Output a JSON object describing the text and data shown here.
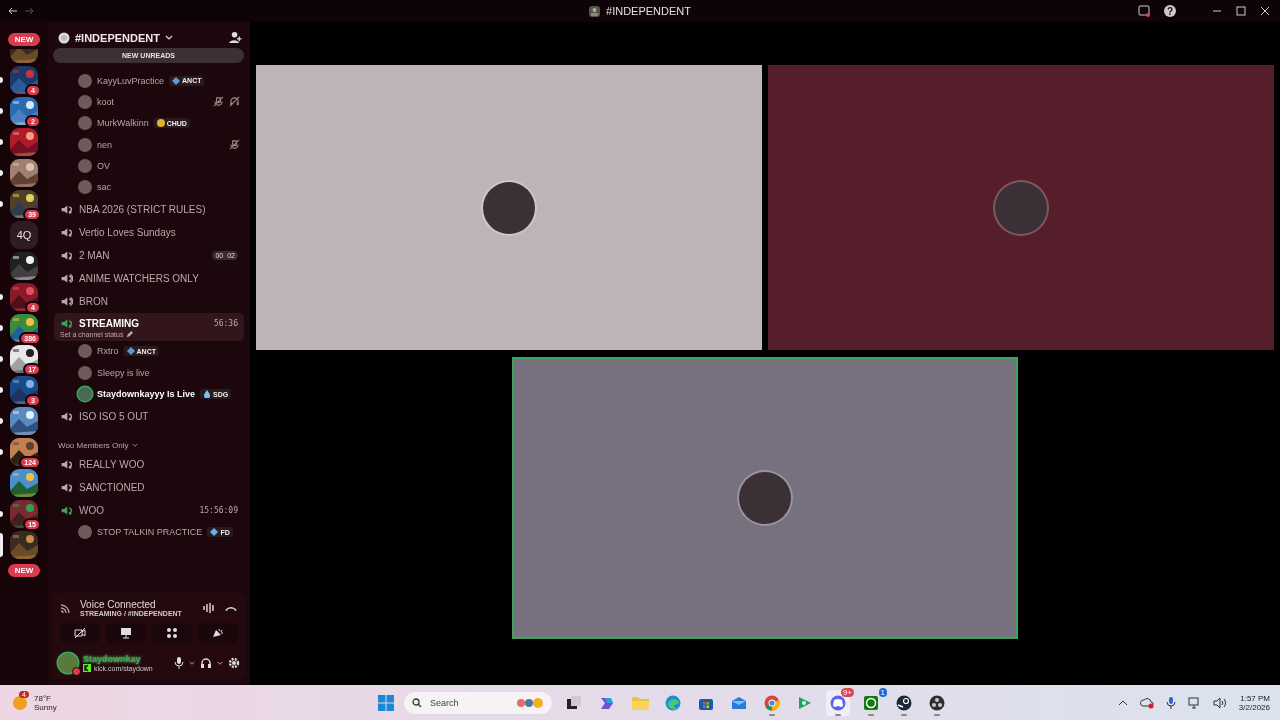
{
  "title_bar": {
    "title": "#INDEPENDENT",
    "help": "?"
  },
  "server_rail": {
    "top_pill": "NEW",
    "bottom_pill": "NEW",
    "servers": [
      {
        "kind": "picture",
        "unread": false,
        "selected": false
      },
      {
        "kind": "picture",
        "unread": true,
        "badge": "4",
        "selected": false
      },
      {
        "kind": "picture",
        "unread": true,
        "badge": "2",
        "selected": false
      },
      {
        "kind": "picture",
        "unread": true,
        "selected": false
      },
      {
        "kind": "picture",
        "unread": true,
        "selected": false
      },
      {
        "kind": "picture",
        "unread": true,
        "badge": "39",
        "selected": false
      },
      {
        "kind": "text",
        "label": "4Q",
        "unread": false,
        "selected": false
      },
      {
        "kind": "picture",
        "unread": false,
        "selected": false
      },
      {
        "kind": "picture",
        "unread": true,
        "badge": "4",
        "selected": false
      },
      {
        "kind": "picture",
        "unread": true,
        "badge": "386",
        "selected": false
      },
      {
        "kind": "picture",
        "unread": true,
        "badge": "17",
        "selected": false
      },
      {
        "kind": "picture",
        "unread": true,
        "badge": "3",
        "selected": false
      },
      {
        "kind": "picture",
        "unread": true,
        "selected": false
      },
      {
        "kind": "picture",
        "unread": true,
        "badge": "124",
        "selected": false
      },
      {
        "kind": "picture",
        "unread": false,
        "selected": false
      },
      {
        "kind": "picture",
        "unread": true,
        "badge": "15",
        "selected": false
      },
      {
        "kind": "picture",
        "unread": false,
        "selected": true
      }
    ]
  },
  "server_header": {
    "name": "#INDEPENDENT",
    "unreads_pill": "NEW UNREADS"
  },
  "top_members": [
    {
      "name": "KayyLuvPractice",
      "tag": {
        "text": "ANCT",
        "kind": "diamond",
        "color": "#5b9bd5"
      },
      "muted": false,
      "deafened": false,
      "speaking": false
    },
    {
      "name": "koot",
      "muted": true,
      "deafened": true,
      "speaking": false
    },
    {
      "name": "MurkWalkinn",
      "tag": {
        "text": "CHUD",
        "kind": "face",
        "color": "#e0b32a"
      },
      "muted": false,
      "deafened": false,
      "speaking": false
    },
    {
      "name": "nen",
      "muted": true,
      "deafened": false,
      "speaking": false
    },
    {
      "name": "OV",
      "muted": false,
      "deafened": false,
      "speaking": false
    },
    {
      "name": "sac",
      "muted": false,
      "deafened": false,
      "speaking": false
    }
  ],
  "channels": [
    {
      "name": "NBA 2026 (STRICT RULES)",
      "locked": true,
      "active": false,
      "selected": false
    },
    {
      "name": "Vertio Loves Sundays",
      "locked": true,
      "active": false,
      "selected": false
    },
    {
      "name": "2 MAN",
      "locked": true,
      "active": false,
      "selected": false,
      "counter": [
        "00",
        "02"
      ]
    },
    {
      "name": "ANIME WATCHERS ONLY",
      "locked": false,
      "active": false,
      "selected": false
    },
    {
      "name": "BRON",
      "locked": false,
      "active": false,
      "selected": false
    },
    {
      "name": "STREAMING",
      "locked": true,
      "active": true,
      "selected": true,
      "timer": "56:36",
      "status": "Set a channel status",
      "members": [
        {
          "name": "Rxtro",
          "tag": {
            "text": "ANCT",
            "kind": "diamond",
            "color": "#5b9bd5"
          },
          "muted": false,
          "deafened": false,
          "speaking": false
        },
        {
          "name": "Sleepy is live",
          "muted": false,
          "deafened": false,
          "speaking": false
        },
        {
          "name": "Staydownkayyy Is Live",
          "tag": {
            "text": "SDG",
            "kind": "drop",
            "color": "#7cc4f0"
          },
          "muted": false,
          "deafened": false,
          "speaking": true
        }
      ]
    },
    {
      "name": "ISO ISO 5 OUT",
      "locked": true,
      "active": false,
      "selected": false
    }
  ],
  "category": {
    "name": "Woo Members Only",
    "channels": [
      {
        "name": "REALLY WOO",
        "locked": true,
        "active": false,
        "selected": false
      },
      {
        "name": "SANCTIONED",
        "locked": true,
        "active": false,
        "selected": false
      },
      {
        "name": "WOO",
        "locked": true,
        "active": true,
        "selected": false,
        "timer": "15:56:09",
        "members": [
          {
            "name": "STOP TALKIN PRACTICE",
            "tag": {
              "text": "FD",
              "kind": "diamond",
              "color": "#6ab0f0"
            },
            "muted": false,
            "deafened": false,
            "speaking": false
          }
        ]
      }
    ]
  },
  "voice_panel": {
    "status": "Voice Connected",
    "channel": "STREAMING / #INDEPENDENT"
  },
  "user_bar": {
    "name": "Staydownkay",
    "activity": "kick.com/staydown"
  },
  "tiles": [
    {
      "color": "#bdb5b5",
      "speaking": false
    },
    {
      "color": "#561e2b",
      "speaking": false
    },
    {
      "color": "#77707f",
      "speaking": true
    }
  ],
  "taskbar": {
    "weather": {
      "temp": "78°F",
      "condition": "Sunny",
      "badge": "4"
    },
    "search": {
      "placeholder": "Search"
    },
    "apps": [
      {
        "kind": "taskview",
        "running": false
      },
      {
        "kind": "m365",
        "running": false
      },
      {
        "kind": "files",
        "running": false
      },
      {
        "kind": "edge",
        "running": false
      },
      {
        "kind": "store",
        "running": false
      },
      {
        "kind": "mail",
        "running": false
      },
      {
        "kind": "chrome",
        "running": true
      },
      {
        "kind": "play",
        "running": false
      },
      {
        "kind": "discord",
        "running": true,
        "badge": "9+"
      },
      {
        "kind": "xbox",
        "running": true,
        "badge": "1"
      },
      {
        "kind": "steam",
        "running": true
      },
      {
        "kind": "obs",
        "running": true
      }
    ],
    "time": "1:57 PM",
    "date": "3/2/2026"
  }
}
